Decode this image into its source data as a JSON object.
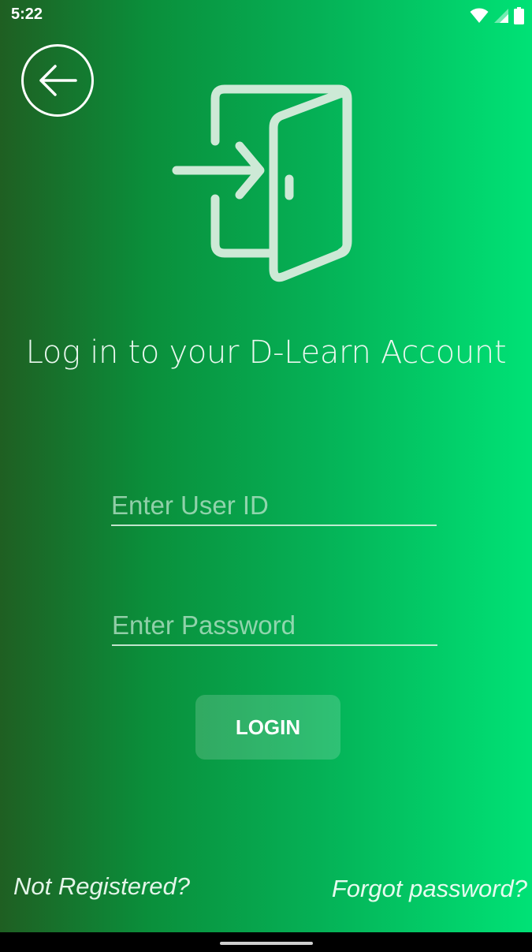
{
  "status_bar": {
    "time": "5:22",
    "icons": [
      "wifi-icon",
      "cellular-signal-icon",
      "battery-icon"
    ]
  },
  "header": {
    "back_icon": "arrow-left-icon",
    "logo_icon": "door-login-icon"
  },
  "main": {
    "title": "Log in to your D-Learn Account",
    "user_id": {
      "placeholder": "Enter User ID",
      "value": ""
    },
    "password": {
      "placeholder": "Enter Password",
      "value": ""
    },
    "login_label": "LOGIN"
  },
  "footer": {
    "not_registered": "Not Registered?",
    "forgot_password": "Forgot password?"
  },
  "colors": {
    "gradient_start": "#1f5f22",
    "gradient_end": "#00e276",
    "text_light": "#e9f7ee"
  }
}
